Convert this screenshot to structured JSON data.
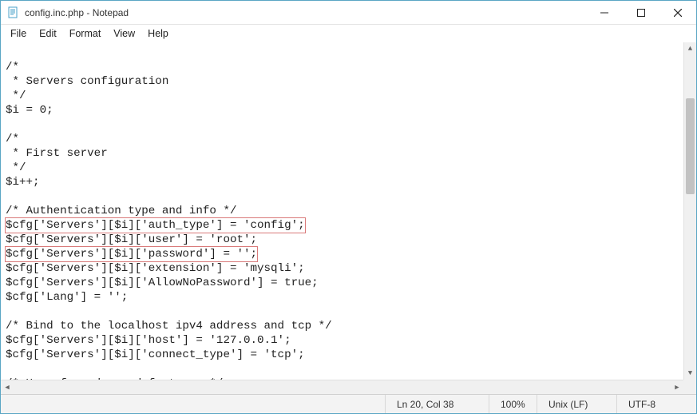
{
  "window": {
    "title": "config.inc.php - Notepad"
  },
  "menu": {
    "file": "File",
    "edit": "Edit",
    "format": "Format",
    "view": "View",
    "help": "Help"
  },
  "code": {
    "lines": [
      "",
      "/*",
      " * Servers configuration",
      " */",
      "$i = 0;",
      "",
      "/*",
      " * First server",
      " */",
      "$i++;",
      "",
      "/* Authentication type and info */",
      "$cfg['Servers'][$i]['auth_type'] = 'config';",
      "$cfg['Servers'][$i]['user'] = 'root';",
      "$cfg['Servers'][$i]['password'] = '';",
      "$cfg['Servers'][$i]['extension'] = 'mysqli';",
      "$cfg['Servers'][$i]['AllowNoPassword'] = true;",
      "$cfg['Lang'] = '';",
      "",
      "/* Bind to the localhost ipv4 address and tcp */",
      "$cfg['Servers'][$i]['host'] = '127.0.0.1';",
      "$cfg['Servers'][$i]['connect_type'] = 'tcp';",
      "",
      "/* User for advanced features */"
    ],
    "highlight_indices": [
      12,
      14
    ]
  },
  "status": {
    "cursor": "Ln 20, Col 38",
    "zoom": "100%",
    "eol": "Unix (LF)",
    "encoding": "UTF-8"
  }
}
